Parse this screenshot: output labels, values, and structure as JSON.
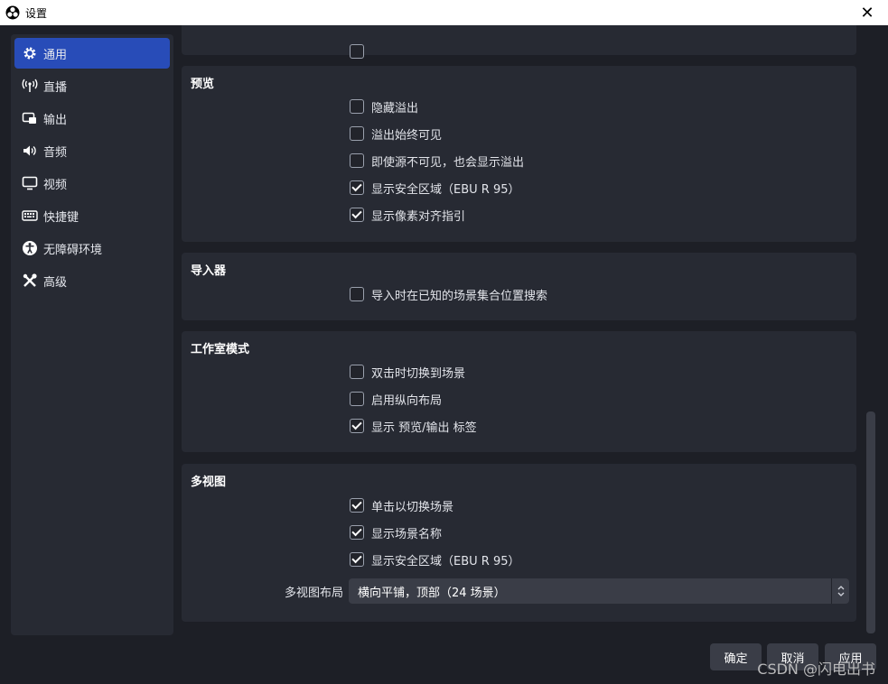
{
  "window": {
    "title": "设置"
  },
  "sidebar": {
    "items": [
      {
        "label": "通用",
        "icon": "gear-icon",
        "active": true
      },
      {
        "label": "直播",
        "icon": "broadcast-icon",
        "active": false
      },
      {
        "label": "输出",
        "icon": "output-icon",
        "active": false
      },
      {
        "label": "音频",
        "icon": "speaker-icon",
        "active": false
      },
      {
        "label": "视频",
        "icon": "monitor-icon",
        "active": false
      },
      {
        "label": "快捷键",
        "icon": "keyboard-icon",
        "active": false
      },
      {
        "label": "无障碍环境",
        "icon": "accessibility-icon",
        "active": false
      },
      {
        "label": "高级",
        "icon": "wrench-icon",
        "active": false
      }
    ]
  },
  "sections": {
    "preview": {
      "title": "预览",
      "options": [
        {
          "label": "隐藏溢出",
          "checked": false
        },
        {
          "label": "溢出始终可见",
          "checked": false
        },
        {
          "label": "即使源不可见，也会显示溢出",
          "checked": false
        },
        {
          "label": "显示安全区域（EBU R 95）",
          "checked": true
        },
        {
          "label": "显示像素对齐指引",
          "checked": true
        }
      ]
    },
    "importer": {
      "title": "导入器",
      "options": [
        {
          "label": "导入时在已知的场景集合位置搜索",
          "checked": false
        }
      ]
    },
    "studio_mode": {
      "title": "工作室模式",
      "options": [
        {
          "label": "双击时切换到场景",
          "checked": false
        },
        {
          "label": "启用纵向布局",
          "checked": false
        },
        {
          "label": "显示 预览/输出 标签",
          "checked": true
        }
      ]
    },
    "multiview": {
      "title": "多视图",
      "options": [
        {
          "label": "单击以切换场景",
          "checked": true
        },
        {
          "label": "显示场景名称",
          "checked": true
        },
        {
          "label": "显示安全区域（EBU R 95）",
          "checked": true
        }
      ],
      "layout_label": "多视图布局",
      "layout_value": "横向平铺，顶部（24 场景）"
    }
  },
  "buttons": {
    "ok": "确定",
    "cancel": "取消",
    "apply": "应用"
  },
  "watermark": "CSDN @闪电出书",
  "colors": {
    "accent": "#284cb8",
    "panel": "#272a33",
    "background": "#1d1f26"
  }
}
